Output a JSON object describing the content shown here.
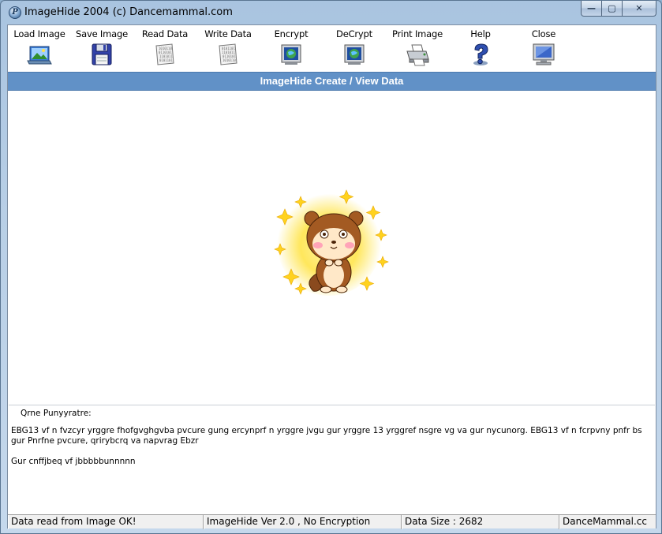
{
  "window": {
    "title": "ImageHide 2004 (c) Dancemammal.com",
    "controls": {
      "minimize": "—",
      "maximize": "▢",
      "close": "✕"
    }
  },
  "toolbar": [
    {
      "id": "load-image",
      "label": "Load Image",
      "icon": "load-image-icon"
    },
    {
      "id": "save-image",
      "label": "Save Image",
      "icon": "floppy-disk-icon"
    },
    {
      "id": "read-data",
      "label": "Read Data",
      "icon": "data-sheet-icon"
    },
    {
      "id": "write-data",
      "label": "Write Data",
      "icon": "data-sheet-icon"
    },
    {
      "id": "encrypt",
      "label": "Encrypt",
      "icon": "globe-screen-icon"
    },
    {
      "id": "decrypt",
      "label": "DeCrypt",
      "icon": "globe-screen-icon"
    },
    {
      "id": "print-image",
      "label": "Print Image",
      "icon": "printer-icon"
    },
    {
      "id": "help",
      "label": "Help",
      "icon": "question-mark-icon"
    },
    {
      "id": "close",
      "label": "Close",
      "icon": "monitor-icon"
    }
  ],
  "header": {
    "title": "ImageHide Create / View Data"
  },
  "text": {
    "heading": "Qrne Punyyratre:",
    "paragraph": "EBG13 vf n fvzcyr yrggre fhofgvghgvba pvcure gung ercynprf n yrggre jvgu gur yrggre 13 yrggref nsgre vg va gur nycunorg. EBG13 vf n fcrpvny pnfr bs gur Pnrfne pvcure, qrirybcrq va napvrag Ebzr",
    "footer": "Gur cnffjbeq vf jbbbbbunnnnn"
  },
  "status": {
    "message": "Data read from Image OK!",
    "version": "ImageHide Ver 2.0 , No Encryption",
    "data_size": "Data Size : 2682",
    "brand": "DanceMammal.cc"
  },
  "colors": {
    "header_bar": "#6191c7",
    "title_gradient": "#a9c4e0"
  }
}
